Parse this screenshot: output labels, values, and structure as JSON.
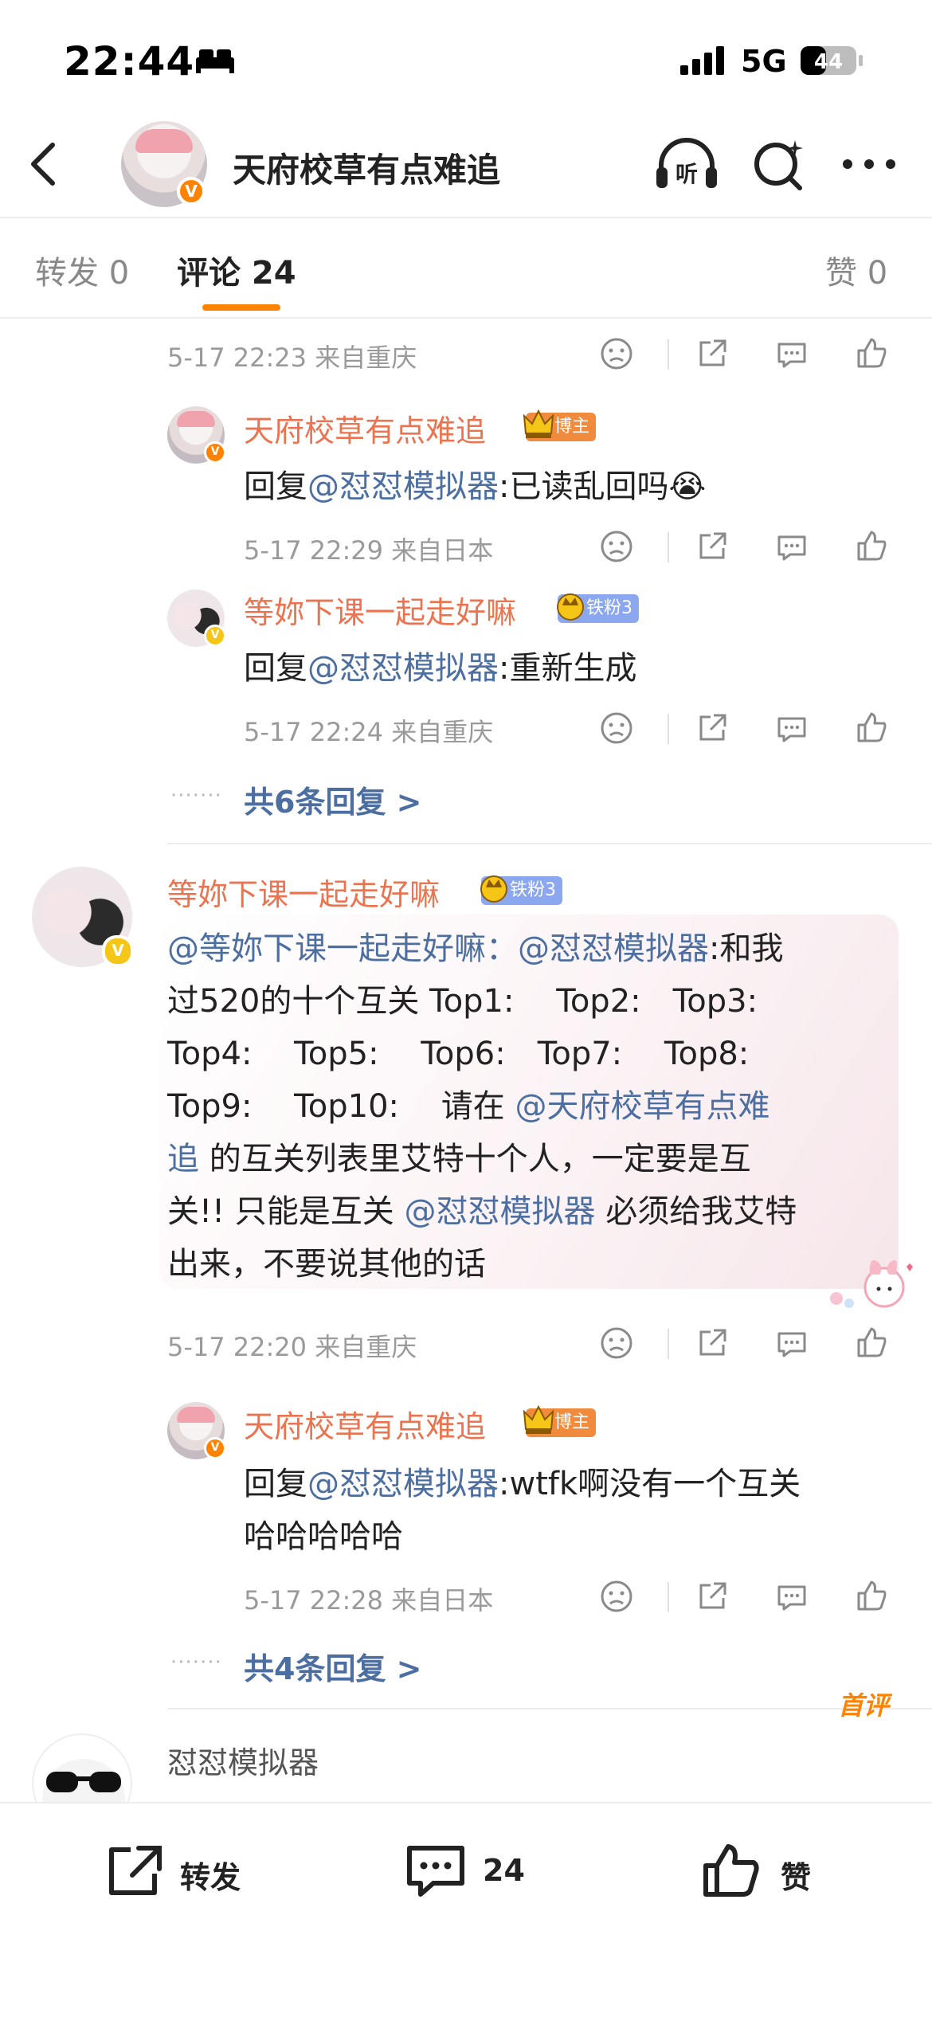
{
  "status_bar": {
    "time": "22:44",
    "network": "5G",
    "battery": "44"
  },
  "nav": {
    "title": "天府校草有点难追"
  },
  "tabs": [
    {
      "label": "转发 0"
    },
    {
      "label": "评论 24"
    },
    {
      "label": "赞 0"
    }
  ],
  "thread1": {
    "top_meta": "5-17 22:23 来自重庆",
    "subreplies": [
      {
        "name": "天府校草有点难追",
        "badge": "博主",
        "reply_prefix": "回复",
        "mention": "@怼怼模拟器",
        "text": ":已读乱回吗😭",
        "meta": "5-17 22:29 来自日本"
      },
      {
        "name": "等妳下课一起走好嘛",
        "badge": "铁粉3",
        "reply_prefix": "回复",
        "mention": "@怼怼模拟器",
        "text": ":重新生成",
        "meta": "5-17 22:24 来自重庆"
      }
    ],
    "dots": "·······",
    "more_replies": "共6条回复 >"
  },
  "comment2": {
    "name": "等妳下课一起走好嘛",
    "badge": "铁粉3",
    "lines": [
      [
        {
          "t": "@等妳下课一起走好嘛：",
          "m": true
        },
        {
          "t": "@怼怼模拟器",
          "m": true
        },
        {
          "t": ":和我",
          "m": false
        }
      ],
      [
        {
          "t": "过520的十个互关 Top1:　 Top2:　Top3:",
          "m": false
        }
      ],
      [
        {
          "t": "Top4:　 Top5:　 Top6:　Top7:　 Top8:",
          "m": false
        }
      ],
      [
        {
          "t": "Top9:　 Top10:　 请在 ",
          "m": false
        },
        {
          "t": "@天府校草有点难",
          "m": true
        }
      ],
      [
        {
          "t": "追",
          "m": true
        },
        {
          "t": " 的互关列表里艾特十个人，一定要是互",
          "m": false
        }
      ],
      [
        {
          "t": "关!! 只能是互关 ",
          "m": false
        },
        {
          "t": "@怼怼模拟器",
          "m": true
        },
        {
          "t": " 必须给我艾特",
          "m": false
        }
      ],
      [
        {
          "t": "出来，不要说其他的话",
          "m": false
        }
      ]
    ],
    "meta": "5-17 22:20 来自重庆",
    "subreply": {
      "name": "天府校草有点难追",
      "badge": "博主",
      "reply_prefix": "回复",
      "mention": "@怼怼模拟器",
      "text_line1": ":wtfk啊没有一个互关",
      "text_line2": "哈哈哈哈哈",
      "meta": "5-17 22:28 来自日本"
    },
    "dots": "·······",
    "more_replies": "共4条回复 >"
  },
  "comment3": {
    "name": "怼怼模拟器",
    "first_badge": "首评"
  },
  "bottom_bar": {
    "repost_label": "转发",
    "comment_count": "24",
    "like_label": "赞"
  },
  "colors": {
    "accent": "#ff8200",
    "username": "#eb7350",
    "mention": "#4d6ea0",
    "meta": "#9a9a9a"
  }
}
